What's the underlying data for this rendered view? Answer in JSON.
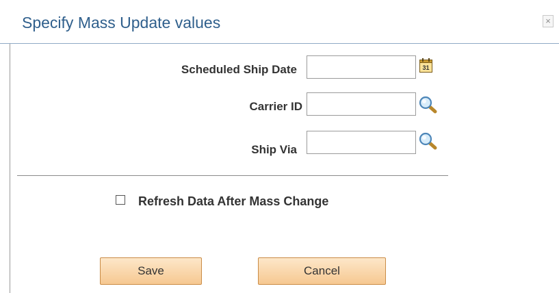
{
  "dialog": {
    "title": "Specify Mass Update values",
    "close_glyph": "×"
  },
  "form": {
    "scheduled_ship_date": {
      "label": "Scheduled Ship Date",
      "value": "",
      "icon": "calendar-icon",
      "icon_text": "31"
    },
    "carrier_id": {
      "label": "Carrier ID",
      "value": "",
      "icon": "search-icon"
    },
    "ship_via": {
      "label": "Ship Via",
      "value": "",
      "icon": "search-icon"
    }
  },
  "options": {
    "refresh_label": "Refresh Data After Mass Change",
    "refresh_checked": false
  },
  "actions": {
    "save_label": "Save",
    "cancel_label": "Cancel"
  },
  "colors": {
    "title": "#2f5f8c",
    "button_border": "#c98b45",
    "button_fill": "#f6c891"
  }
}
